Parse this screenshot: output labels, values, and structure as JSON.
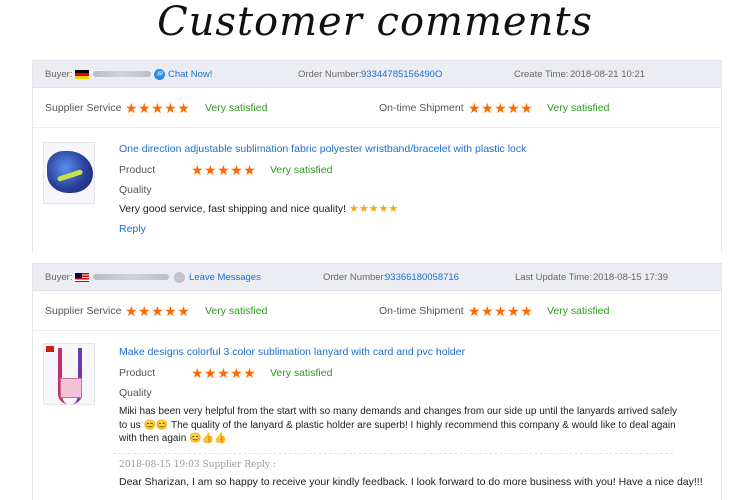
{
  "page": {
    "title": "Customer comments"
  },
  "colors": {
    "star": "#ff6a00",
    "satisfied": "#2e9a1f",
    "link": "#1a6fd0",
    "meta_bg": "#ebedf2"
  },
  "reviews": [
    {
      "buyer_label": "Buyer:",
      "buyer_country_flag": "germany-flag",
      "contact_label": "Chat Now!",
      "contact_icon": "chat-icon",
      "order_label": "Order Number:",
      "order_number": "93344785156490O",
      "time_label": "Create Time:",
      "time_value": "2018-08-21 10:21",
      "supplier_service_label": "Supplier Service",
      "supplier_service_stars": "★★★★★",
      "supplier_service_rating": "Very satisfied",
      "shipment_label": "On-time Shipment",
      "shipment_stars": "★★★★★",
      "shipment_rating": "Very satisfied",
      "product_title": "One direction adjustable sublimation fabric polyester wristband/bracelet with plastic lock",
      "product_label": "Product",
      "product_stars": "★★★★★",
      "product_rating": "Very satisfied",
      "quality_label": "Quality",
      "comment": "Very good service, fast shipping and nice quality!",
      "comment_stars": "★★★★★",
      "reply_label": "Reply"
    },
    {
      "buyer_label": "Buyer:",
      "buyer_country_flag": "malaysia-flag",
      "contact_label": "Leave Messages",
      "contact_icon": "message-icon",
      "order_label": "Order Number:",
      "order_number": "93366180058716",
      "time_label": "Last Update Time:",
      "time_value": "2018-08-15 17:39",
      "supplier_service_label": "Supplier Service",
      "supplier_service_stars": "★★★★★",
      "supplier_service_rating": "Very satisfied",
      "shipment_label": "On-time Shipment",
      "shipment_stars": "★★★★★",
      "shipment_rating": "Very satisfied",
      "product_title": "Make designs colorful 3 color sublimation lanyard with card and pvc holder",
      "product_label": "Product",
      "product_stars": "★★★★★",
      "product_rating": "Very satisfied",
      "quality_label": "Quality",
      "comment_line1": "Miki has been very helpful from the start with so many demands and changes from our side up until the lanyards arrived safely",
      "comment_line2": "to us 😊😊 The quality of the lanyard & plastic holder are superb! I highly recommend this company & would like to deal again",
      "comment_line3": "with then again 😊👍👍",
      "supplier_reply_meta": "2018-08-15 19:03  Supplier Reply :",
      "supplier_reply_text": "Dear Sharizan, I am so happy to receive your kindly feedback. I look forward to do more business with you! Have a nice day!!!"
    }
  ]
}
